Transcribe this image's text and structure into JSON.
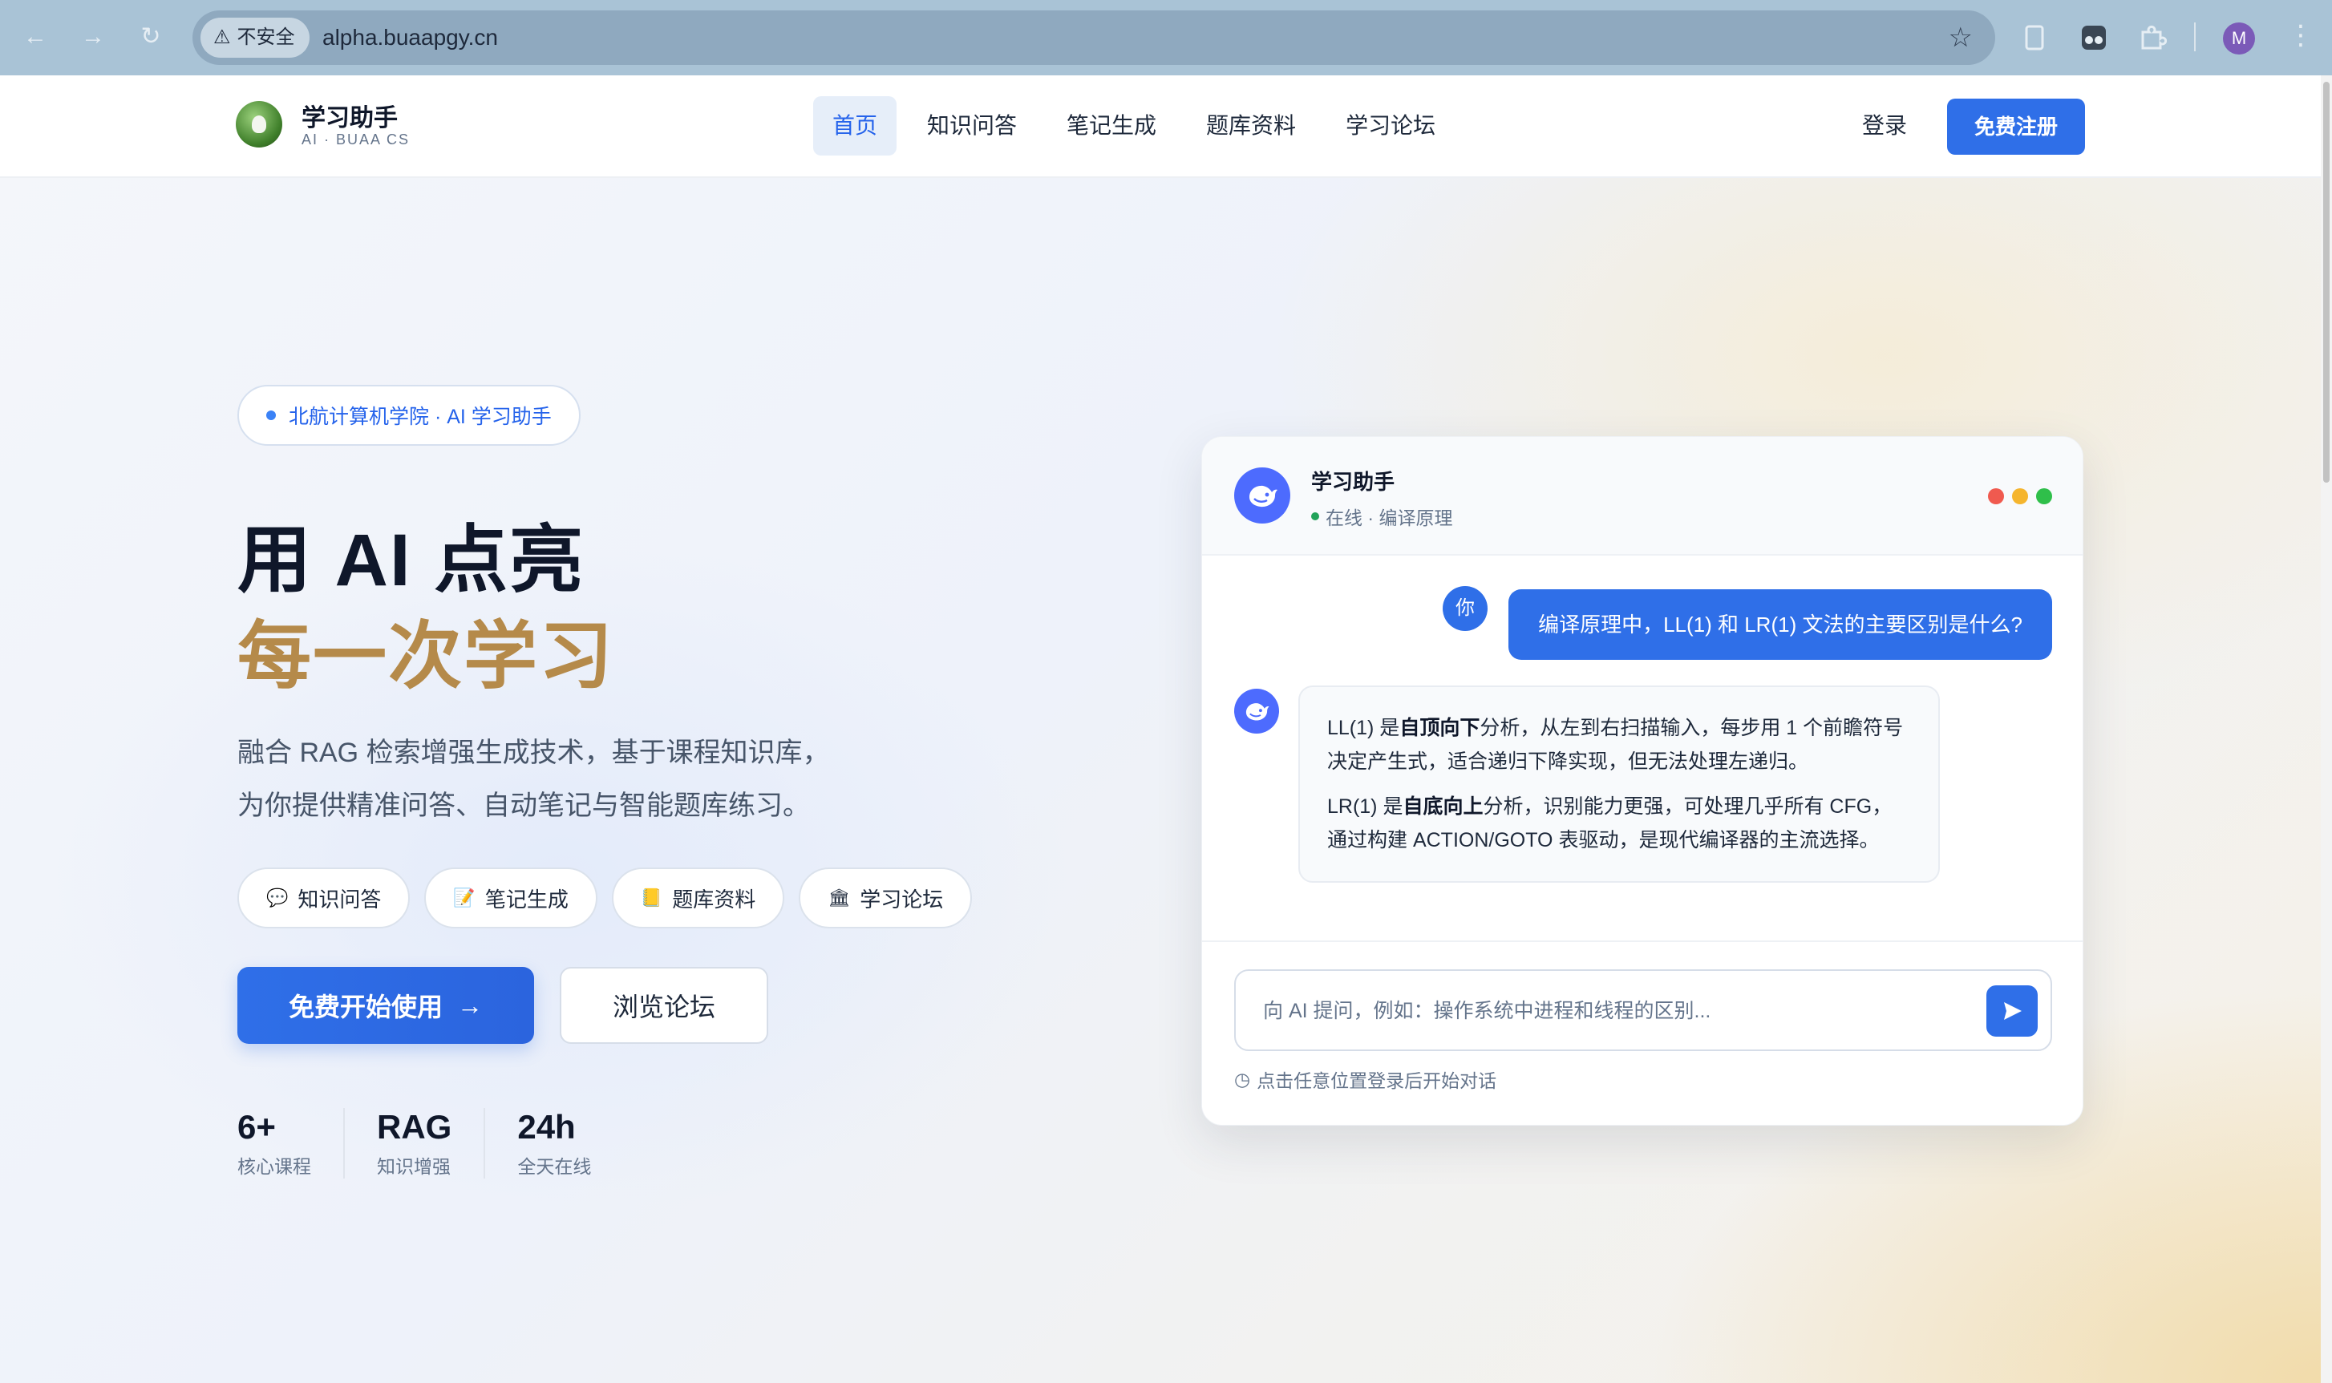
{
  "browser": {
    "security_label": "不安全",
    "url": "alpha.buaapgy.cn",
    "profile_initial": "M"
  },
  "header": {
    "brand_name": "学习助手",
    "brand_sub": "AI · BUAA CS",
    "nav": [
      {
        "label": "首页",
        "active": true
      },
      {
        "label": "知识问答",
        "active": false
      },
      {
        "label": "笔记生成",
        "active": false
      },
      {
        "label": "题库资料",
        "active": false
      },
      {
        "label": "学习论坛",
        "active": false
      }
    ],
    "login_label": "登录",
    "signup_label": "免费注册"
  },
  "hero": {
    "pill": "北航计算机学院 · AI 学习助手",
    "title_line1": "用 AI 点亮",
    "title_line2": "每一次学习",
    "desc_line1": "融合 RAG 检索增强生成技术，基于课程知识库，",
    "desc_line2": "为你提供精准问答、自动笔记与智能题库练习。",
    "chips": [
      {
        "icon": "💬",
        "icon_name": "speech-bubble-icon",
        "label": "知识问答"
      },
      {
        "icon": "📝",
        "icon_name": "memo-icon",
        "label": "笔记生成"
      },
      {
        "icon": "📒",
        "icon_name": "notebook-icon",
        "label": "题库资料"
      },
      {
        "icon": "🏛",
        "icon_name": "classical-building-icon",
        "label": "学习论坛"
      }
    ],
    "cta_primary": "免费开始使用",
    "cta_secondary": "浏览论坛",
    "stats": [
      {
        "num": "6+",
        "label": "核心课程"
      },
      {
        "num": "RAG",
        "label": "知识增强"
      },
      {
        "num": "24h",
        "label": "全天在线"
      }
    ]
  },
  "chat": {
    "title": "学习助手",
    "status": "在线 · 编译原理",
    "user_avatar": "你",
    "user_message": "编译原理中，LL(1) 和 LR(1) 文法的主要区别是什么?",
    "answer": {
      "p1_pre": "LL(1) 是",
      "p1_bold": "自顶向下",
      "p1_post": "分析，从左到右扫描输入，每步用 1 个前瞻符号决定产生式，适合递归下降实现，但无法处理左递归。",
      "p2_pre": "LR(1) 是",
      "p2_bold": "自底向上",
      "p2_post": "分析，识别能力更强，可处理几乎所有 CFG，通过构建 ACTION/GOTO 表驱动，是现代编译器的主流选择。"
    },
    "input_placeholder": "向 AI 提问，例如：操作系统中进程和线程的区别...",
    "hint": "点击任意位置登录后开始对话"
  },
  "colors": {
    "accent": "#2f6fe8",
    "gold": "#b58a4a",
    "bot": "#4d6bfe",
    "traffic_red": "#f05a4f",
    "traffic_yellow": "#f5b52e",
    "traffic_green": "#2fbf4a"
  }
}
